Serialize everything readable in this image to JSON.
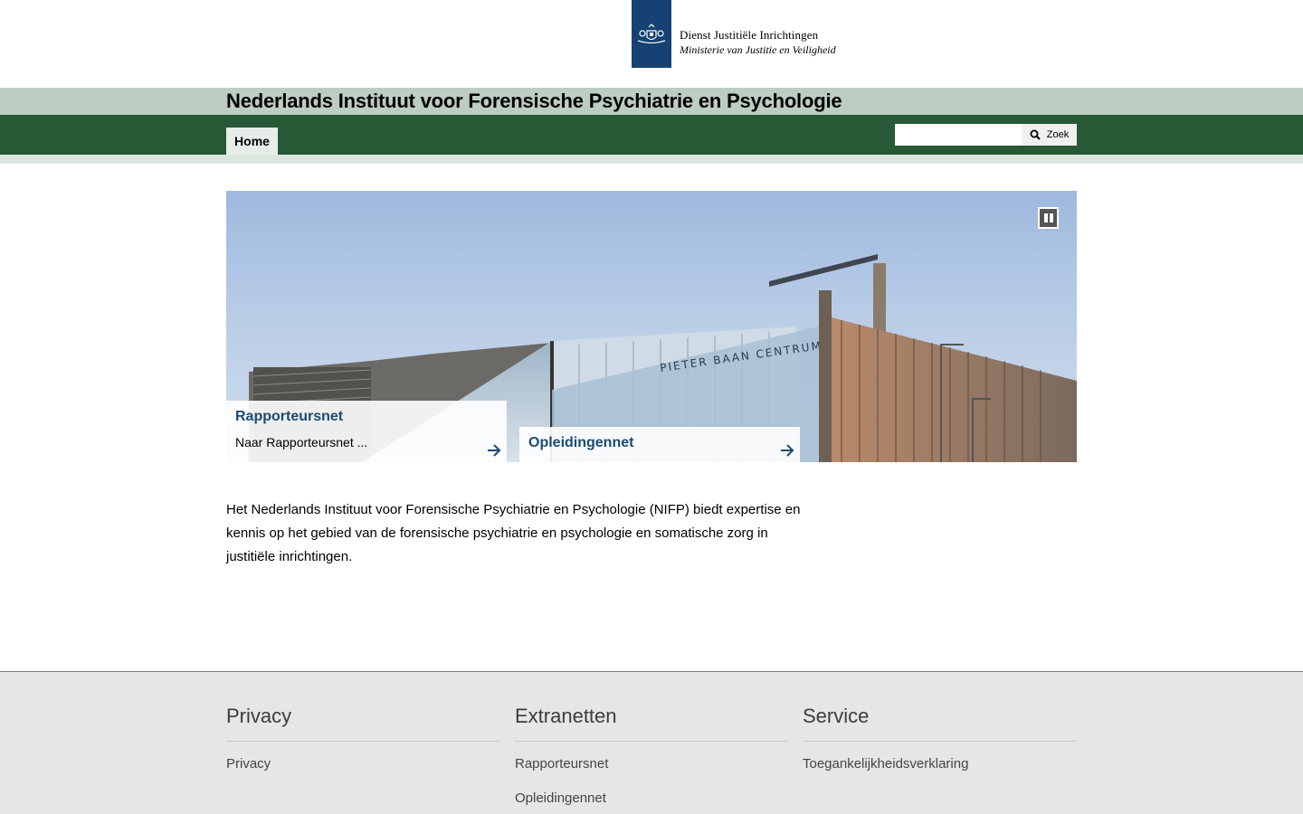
{
  "header": {
    "org_name": "Dienst Justitiële Inrichtingen",
    "ministry": "Ministerie van Justitie en Veiligheid"
  },
  "site_title": "Nederlands Instituut voor Forensische Psychiatrie en Psychologie",
  "nav": {
    "items": [
      {
        "label": "Home"
      }
    ]
  },
  "search": {
    "placeholder": "",
    "button_label": "Zoek"
  },
  "hero": {
    "building_sign": "PIETER BAAN CENTRUM",
    "teasers": [
      {
        "title": "Rapporteursnet",
        "description": "Naar Rapporteursnet ..."
      },
      {
        "title": "Opleidingennet"
      }
    ]
  },
  "intro": {
    "text": "Het Nederlands Instituut voor Forensische Psychiatrie en Psychologie (NIFP) biedt expertise en kennis op het gebied van de forensische psychiatrie en psychologie en somatische zorg in justitiële inrichtingen."
  },
  "footer": {
    "columns": [
      {
        "heading": "Privacy",
        "links": [
          "Privacy"
        ]
      },
      {
        "heading": "Extranetten",
        "links": [
          "Rapporteursnet",
          "Opleidingennet"
        ]
      },
      {
        "heading": "Service",
        "links": [
          "Toegankelijkheidsverklaring"
        ]
      }
    ]
  },
  "colors": {
    "logo_blue": "#154273",
    "title_band": "#bccdc2",
    "nav_green": "#275937",
    "teaser_title": "#1b4a74",
    "footer_bg": "#e6e6e6"
  }
}
